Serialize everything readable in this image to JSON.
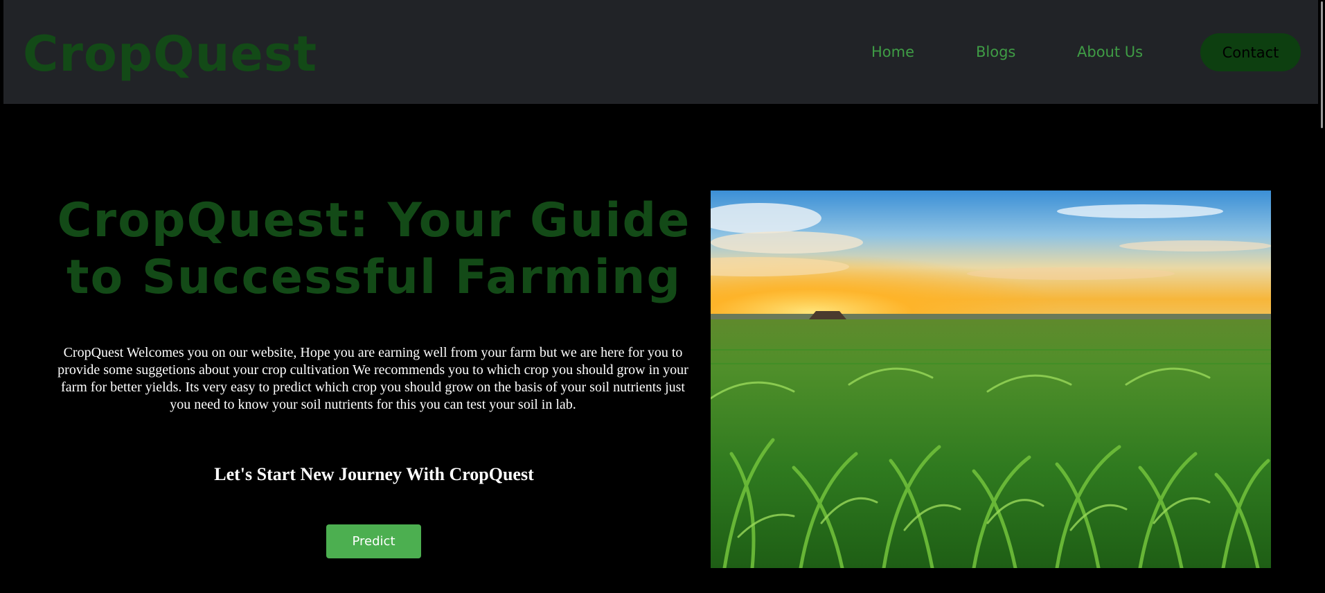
{
  "header": {
    "brand": "CropQuest",
    "nav": {
      "home": "Home",
      "blogs": "Blogs",
      "about": "About Us",
      "contact": "Contact"
    }
  },
  "hero": {
    "title": "CropQuest: Your Guide to Successful Farming",
    "description": "CropQuest Welcomes you on our website, Hope you are earning well from your farm but we are here for you to provide some suggetions about your crop cultivation We recommends you to which crop you should grow in your farm for better yields. Its very easy to predict which crop you should grow on the basis of your soil nutrients just you need to know your soil nutrients for this you can test your soil in lab.",
    "subheading": "Let's Start New Journey With CropQuest",
    "predict_label": "Predict",
    "image_icon": "cornfield-sunset-photo"
  },
  "colors": {
    "background": "#000000",
    "navbar": "#212327",
    "brand_green": "#134a17",
    "nav_link": "#3f9c45",
    "contact_bg": "#0d3f10",
    "predict_bg": "#4caf50"
  }
}
